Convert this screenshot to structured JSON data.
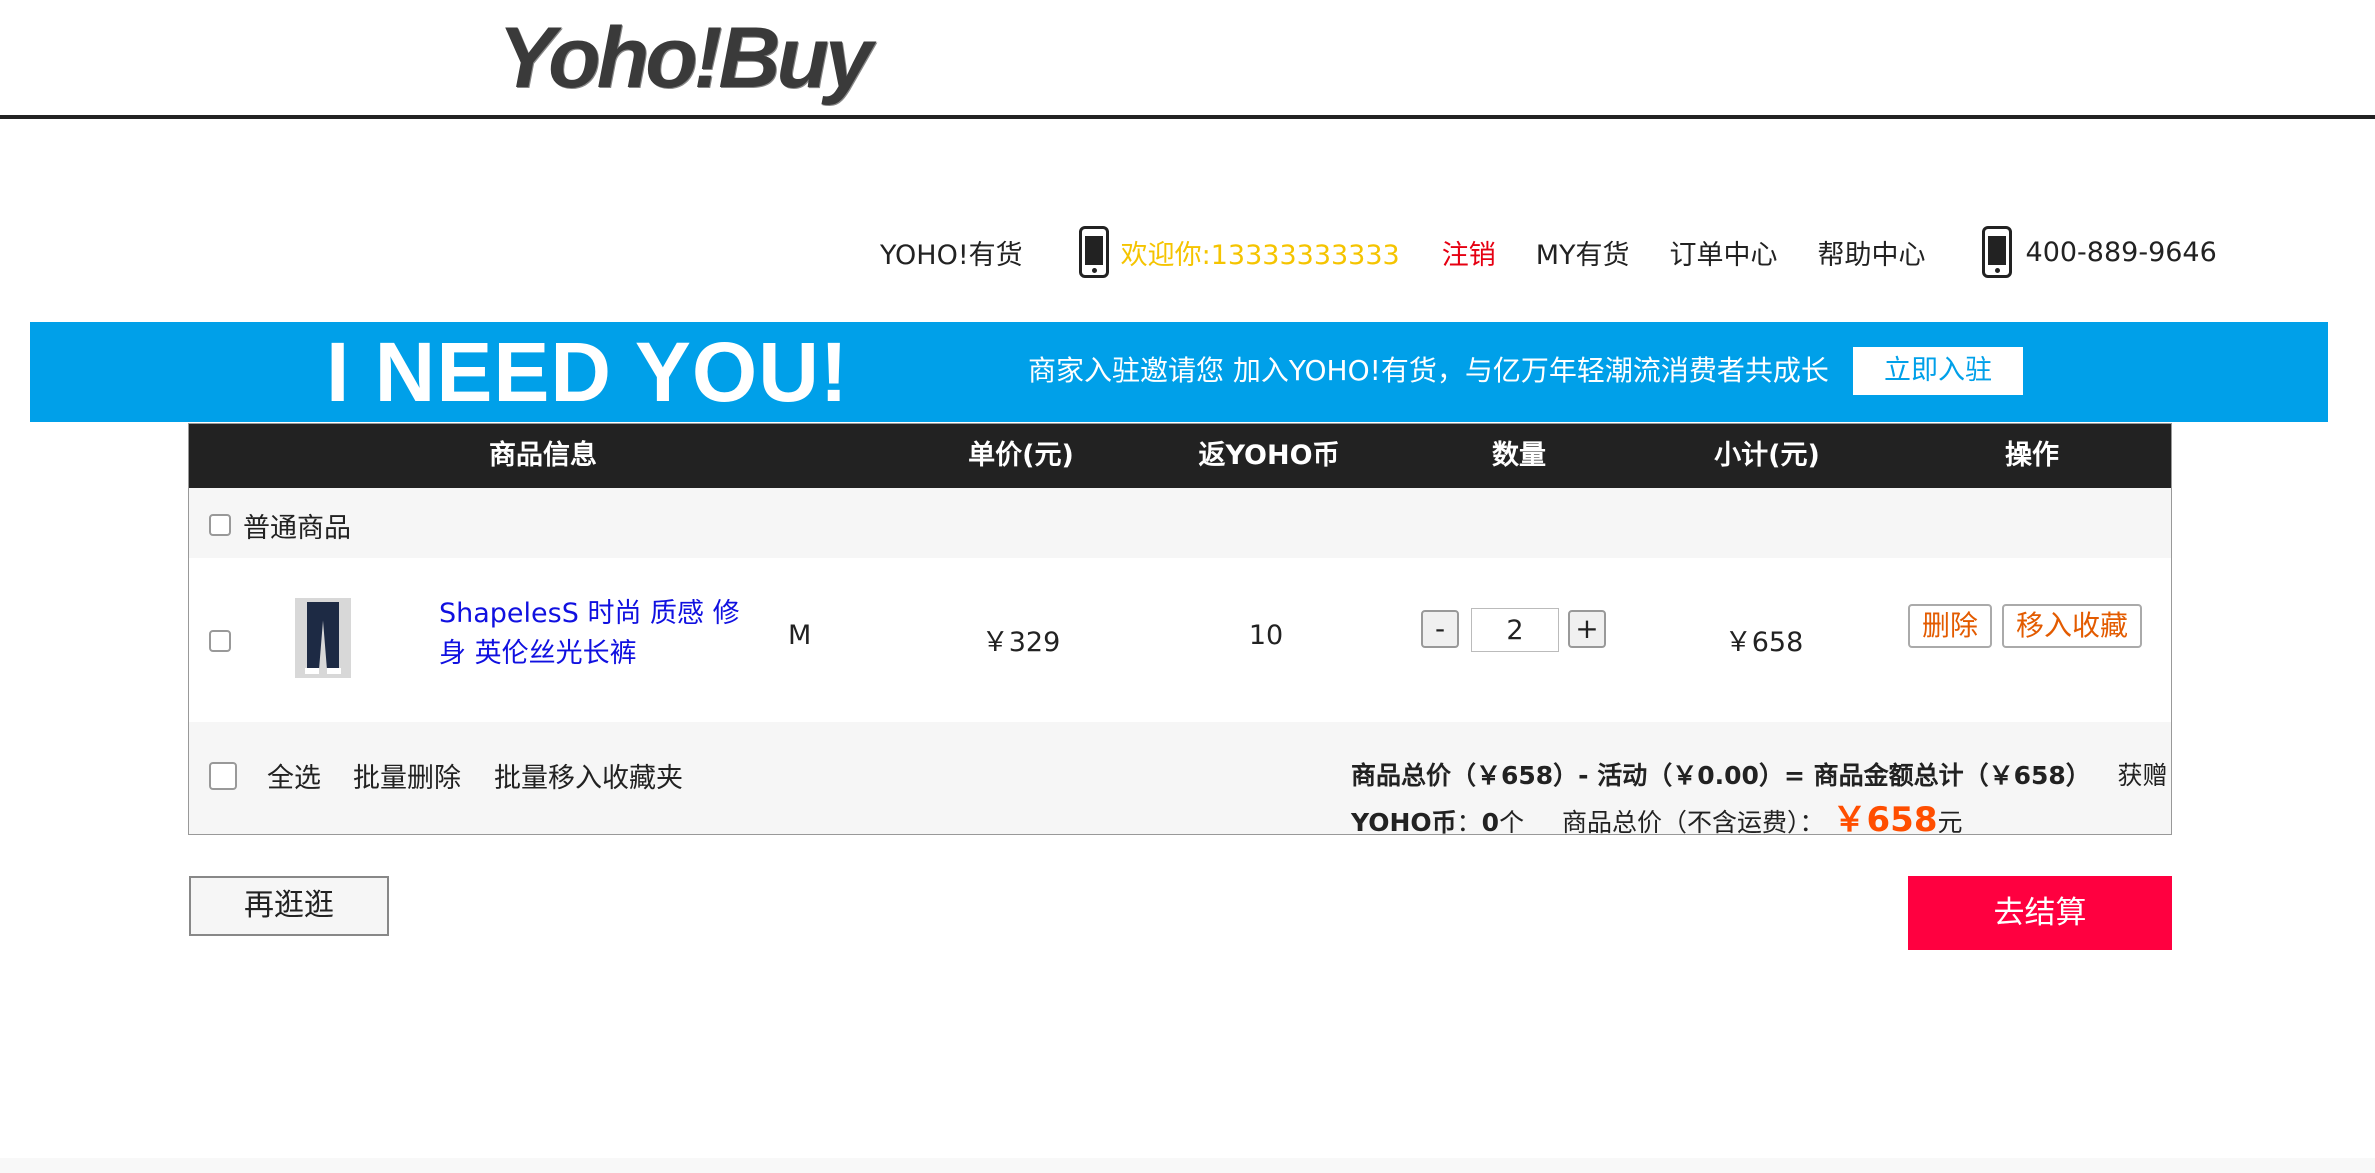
{
  "header": {
    "logo_text": "Yoho!Buy"
  },
  "topnav": {
    "brand": "YOHO!有货",
    "welcome": "欢迎你:13333333333",
    "logout": "注销",
    "my": "MY有货",
    "orders": "订单中心",
    "help": "帮助中心",
    "phone": "400-889-9646"
  },
  "banner": {
    "headline": "I NEED YOU!",
    "text": "商家入驻邀请您  加入YOHO!有货，与亿万年轻潮流消费者共成长",
    "button": "立即入驻"
  },
  "cart": {
    "columns": [
      "商品信息",
      "单价(元)",
      "返YOHO币",
      "数量",
      "小计(元)",
      "操作"
    ],
    "group_label": "普通商品",
    "items": [
      {
        "name": "ShapelesS 时尚 质感 修身 英伦丝光长裤",
        "size": "M",
        "unit_price": "￥329",
        "yoho_coins": "10",
        "quantity": "2",
        "subtotal": "￥658",
        "delete_label": "删除",
        "favorite_label": "移入收藏",
        "minus": "-",
        "plus": "+"
      }
    ],
    "footer": {
      "select_all": "全选",
      "batch_delete": "批量删除",
      "batch_favorite": "批量移入收藏夹",
      "summary_line1": "商品总价（￥658）- 活动（￥0.00）= 商品金额总计（￥658）",
      "summary_gift": "获赠",
      "summary_coins_label": "YOHO币",
      "summary_coins_sep": "：",
      "summary_coins_value": "0",
      "summary_coins_unit": "个",
      "summary_total_label": "商品总价（不含运费）：",
      "summary_total": "￥658",
      "summary_total_unit": "元"
    }
  },
  "actions": {
    "continue": "再逛逛",
    "checkout": "去结算"
  },
  "colors": {
    "banner": "#00a0e9",
    "welcome": "#f5c400",
    "logout": "#e60012",
    "product_link": "#1010e0",
    "operation": "#e35b00",
    "total_price": "#ff4e00",
    "checkout": "#ff0040",
    "table_header": "#222222"
  }
}
